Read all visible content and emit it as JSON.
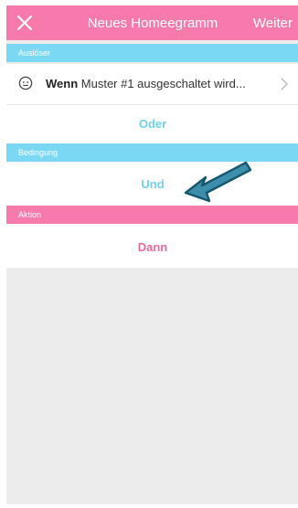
{
  "colors": {
    "nav_bg": "#f67aab",
    "trigger_header": "#7ad8f5",
    "condition_header": "#7ad8f5",
    "action_header": "#f67aab",
    "oder_text": "#70d2f1",
    "und_text": "#70d2f1",
    "dann_text": "#e96aa3",
    "arrow_fill": "#3c8eac",
    "arrow_stroke": "#14586f"
  },
  "navbar": {
    "close_icon": "close-icon",
    "title": "Neues Homeegramm",
    "next_label": "Weiter"
  },
  "trigger": {
    "header": "Auslöser",
    "item_icon": "smiley-icon",
    "item_bold": "Wenn",
    "item_text": " Muster #1 ausgeschaltet wird...",
    "or_label": "Oder"
  },
  "condition": {
    "header": "Bedingung",
    "and_label": "Und"
  },
  "action": {
    "header": "Aktion",
    "then_label": "Dann"
  },
  "annotation": {
    "icon": "arrow-pointer-icon"
  }
}
